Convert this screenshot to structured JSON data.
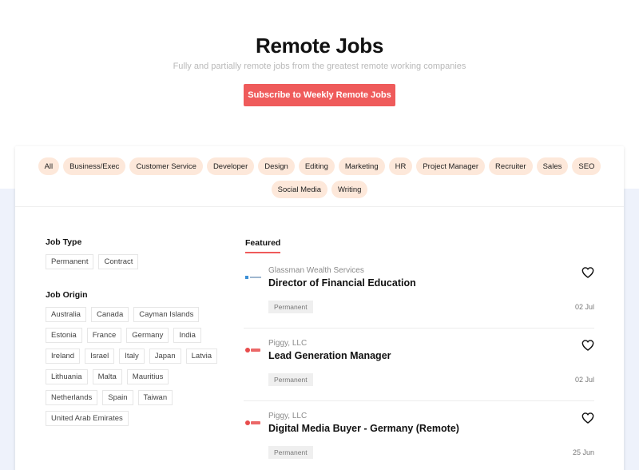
{
  "hero": {
    "title": "Remote Jobs",
    "subtitle": "Fully and partially remote jobs from the greatest remote working companies",
    "subscribe_label": "Subscribe to Weekly Remote Jobs"
  },
  "categories": [
    "All",
    "Business/Exec",
    "Customer Service",
    "Developer",
    "Design",
    "Editing",
    "Marketing",
    "HR",
    "Project Manager",
    "Recruiter",
    "Sales",
    "SEO",
    "Social Media",
    "Writing"
  ],
  "filters": {
    "job_type": {
      "heading": "Job Type",
      "options": [
        "Permanent",
        "Contract"
      ]
    },
    "job_origin": {
      "heading": "Job Origin",
      "options": [
        "Australia",
        "Canada",
        "Cayman Islands",
        "Estonia",
        "France",
        "Germany",
        "India",
        "Ireland",
        "Israel",
        "Italy",
        "Japan",
        "Latvia",
        "Lithuania",
        "Malta",
        "Mauritius",
        "Netherlands",
        "Spain",
        "Taiwan",
        "United Arab Emirates"
      ]
    }
  },
  "featured_tab": "Featured",
  "jobs": [
    {
      "company": "Glassman Wealth Services",
      "title": "Director of Financial Education",
      "type": "Permanent",
      "date": "02 Jul",
      "logo": "glassman-logo"
    },
    {
      "company": "Piggy, LLC",
      "title": "Lead Generation Manager",
      "type": "Permanent",
      "date": "02 Jul",
      "logo": "piggy-logo"
    },
    {
      "company": "Piggy, LLC",
      "title": "Digital Media Buyer - Germany (Remote)",
      "type": "Permanent",
      "date": "25 Jun",
      "logo": "piggy-logo"
    }
  ],
  "colors": {
    "accent": "#ef5b5b",
    "category_bg": "#fde8da",
    "lower_bg": "#eef2fb"
  }
}
